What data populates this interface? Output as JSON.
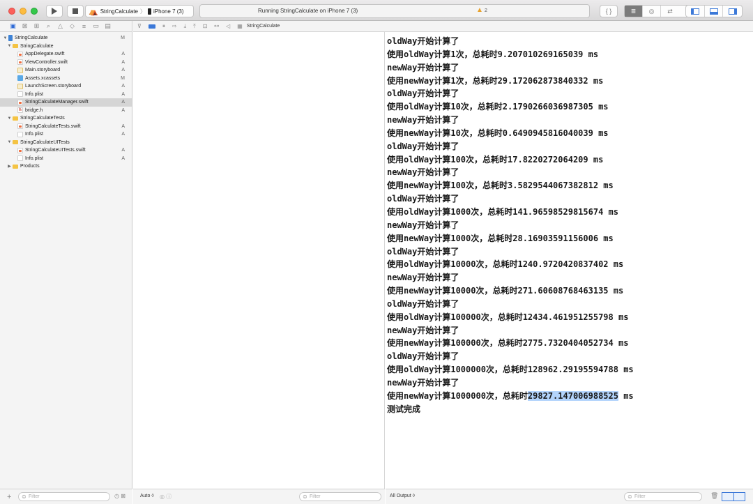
{
  "toolbar": {
    "scheme_name": "StringCalculate",
    "device_name": "iPhone 7 (3)",
    "activity_status": "Running StringCalculate on iPhone 7 (3)",
    "warning_count": "2",
    "braces_label": "{ }"
  },
  "debugbar": {
    "breadcrumb": "StringCalculate"
  },
  "navigator": {
    "items": [
      {
        "label": "StringCalculate",
        "badge": "M"
      },
      {
        "label": "StringCalculate",
        "badge": ""
      },
      {
        "label": "AppDelegate.swift",
        "badge": "A"
      },
      {
        "label": "ViewController.swift",
        "badge": "A"
      },
      {
        "label": "Main.storyboard",
        "badge": "A"
      },
      {
        "label": "Assets.xcassets",
        "badge": "M"
      },
      {
        "label": "LaunchScreen.storyboard",
        "badge": "A"
      },
      {
        "label": "Info.plist",
        "badge": "A"
      },
      {
        "label": "StringCalculateManager.swift",
        "badge": "A"
      },
      {
        "label": "bridge.h",
        "badge": "A"
      },
      {
        "label": "StringCalculateTests",
        "badge": ""
      },
      {
        "label": "StringCalculateTests.swift",
        "badge": "A"
      },
      {
        "label": "Info.plist",
        "badge": "A"
      },
      {
        "label": "StringCalculateUITests",
        "badge": ""
      },
      {
        "label": "StringCalculateUITests.swift",
        "badge": "A"
      },
      {
        "label": "Info.plist",
        "badge": "A"
      },
      {
        "label": "Products",
        "badge": ""
      }
    ],
    "filter_placeholder": "Filter"
  },
  "variables": {
    "scope_label": "Auto ◊",
    "filter_placeholder": "Filter"
  },
  "console": {
    "output_label": "All Output ◊",
    "filter_placeholder": "Filter",
    "lines": [
      "oldWay开始计算了",
      "使用oldWay计算1次，总耗时9.207010269165039 ms",
      "newWay开始计算了",
      "使用newWay计算1次，总耗时29.172062873840332 ms",
      "oldWay开始计算了",
      "使用oldWay计算10次，总耗时2.1790266036987305 ms",
      "newWay开始计算了",
      "使用newWay计算10次，总耗时0.6490945816040039 ms",
      "oldWay开始计算了",
      "使用oldWay计算100次，总耗时17.8220272064209 ms",
      "newWay开始计算了",
      "使用newWay计算100次，总耗时3.5829544067382812 ms",
      "oldWay开始计算了",
      "使用oldWay计算1000次，总耗时141.96598529815674 ms",
      "newWay开始计算了",
      "使用newWay计算1000次，总耗时28.16903591156006 ms",
      "oldWay开始计算了",
      "使用oldWay计算10000次，总耗时1240.9720420837402 ms",
      "newWay开始计算了",
      "使用newWay计算10000次，总耗时271.60608768463135 ms",
      "oldWay开始计算了",
      "使用oldWay计算100000次，总耗时12434.461951255798 ms",
      "newWay开始计算了",
      "使用newWay计算100000次，总耗时2775.7320404052734 ms",
      "oldWay开始计算了",
      "使用oldWay计算1000000次，总耗时128962.29195594788 ms",
      "newWay开始计算了"
    ],
    "last_line_prefix": "使用newWay计算1000000次，总耗时",
    "last_line_selected": "29827.147006988525",
    "last_line_suffix": " ms",
    "final_line": "测试完成"
  }
}
